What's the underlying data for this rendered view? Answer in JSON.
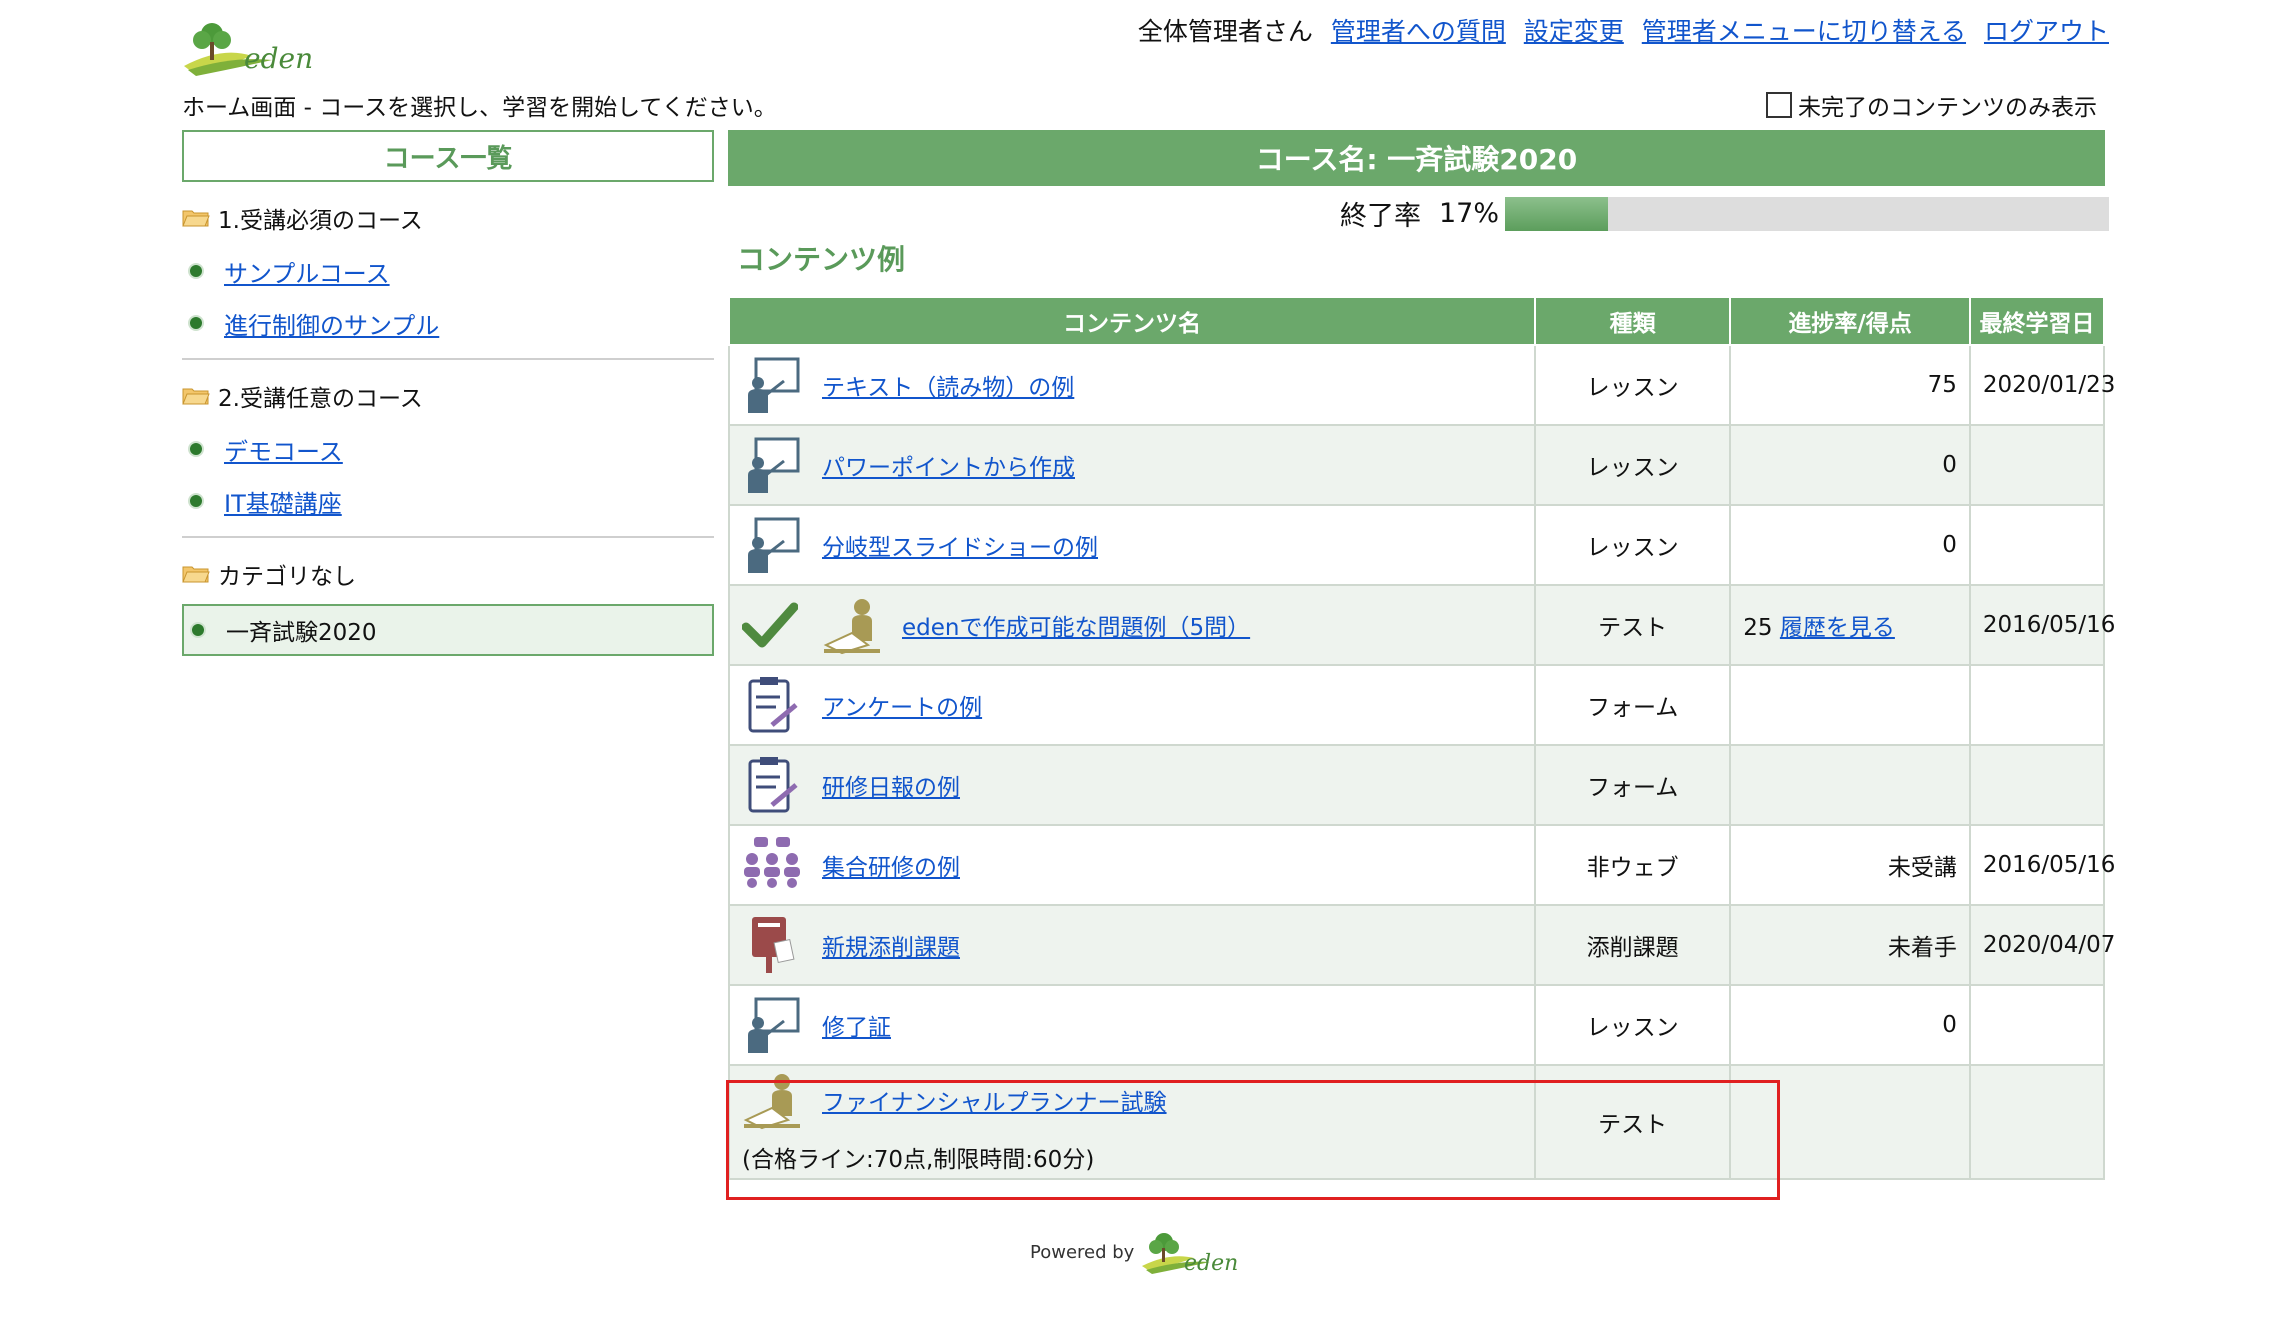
{
  "app": {
    "logo_text": "eden"
  },
  "header": {
    "user_greeting": "全体管理者さん",
    "links": [
      "管理者への質問",
      "設定変更",
      "管理者メニューに切り替える",
      "ログアウト"
    ],
    "subtitle": "ホーム画面 - コースを選択し、学習を開始してください。",
    "filter_label": "未完了のコンテンツのみ表示",
    "filter_checked": false
  },
  "sidebar": {
    "title": "コース一覧",
    "groups": [
      {
        "label": "1.受講必須のコース",
        "items": [
          "サンプルコース",
          "進行制御のサンプル"
        ]
      },
      {
        "label": "2.受講任意のコース",
        "items": [
          "デモコース",
          "IT基礎講座"
        ]
      },
      {
        "label": "カテゴリなし",
        "active_item": "一斉試験2020"
      }
    ]
  },
  "main": {
    "course_title": "コース名: 一斉試験2020",
    "progress_label": "終了率",
    "progress_text": "17%",
    "progress_value": 0.17,
    "section_title": "コンテンツ例",
    "columns": [
      "コンテンツ名",
      "種類",
      "進捗率/得点",
      "最終学習日"
    ],
    "rows": [
      {
        "icon": "lesson-icon",
        "name": "テキスト（読み物）の例",
        "type": "レッスン",
        "progress": "75",
        "date": "2020/01/23"
      },
      {
        "icon": "lesson-icon",
        "name": "パワーポイントから作成",
        "type": "レッスン",
        "progress": "0",
        "date": ""
      },
      {
        "icon": "lesson-icon",
        "name": "分岐型スライドショーの例",
        "type": "レッスン",
        "progress": "0",
        "date": ""
      },
      {
        "icon": "test-icon",
        "completed": true,
        "name": "edenで作成可能な問題例（5問）",
        "type": "テスト",
        "progress": "25",
        "history_link": "履歴を見る",
        "date": "2016/05/16"
      },
      {
        "icon": "form-icon",
        "name": "アンケートの例",
        "type": "フォーム",
        "progress": "",
        "date": ""
      },
      {
        "icon": "form-icon",
        "name": "研修日報の例",
        "type": "フォーム",
        "progress": "",
        "date": ""
      },
      {
        "icon": "group-training-icon",
        "name": "集合研修の例",
        "type": "非ウェブ",
        "progress": "未受講",
        "date": "2016/05/16"
      },
      {
        "icon": "postbox-icon",
        "name": "新規添削課題",
        "type": "添削課題",
        "progress": "未着手",
        "date": "2020/04/07"
      },
      {
        "icon": "lesson-icon",
        "name": "修了証",
        "type": "レッスン",
        "progress": "0",
        "date": ""
      },
      {
        "icon": "test-icon",
        "name": "ファイナンシャルプランナー試験",
        "note": "(合格ライン:70点,制限時間:60分)",
        "type": "テスト",
        "progress": "",
        "date": ""
      }
    ]
  },
  "footer": {
    "powered_by": "Powered by"
  },
  "colors": {
    "accent_green": "#6ba86b",
    "link_blue": "#1155cc",
    "highlight_red": "#e02020"
  }
}
